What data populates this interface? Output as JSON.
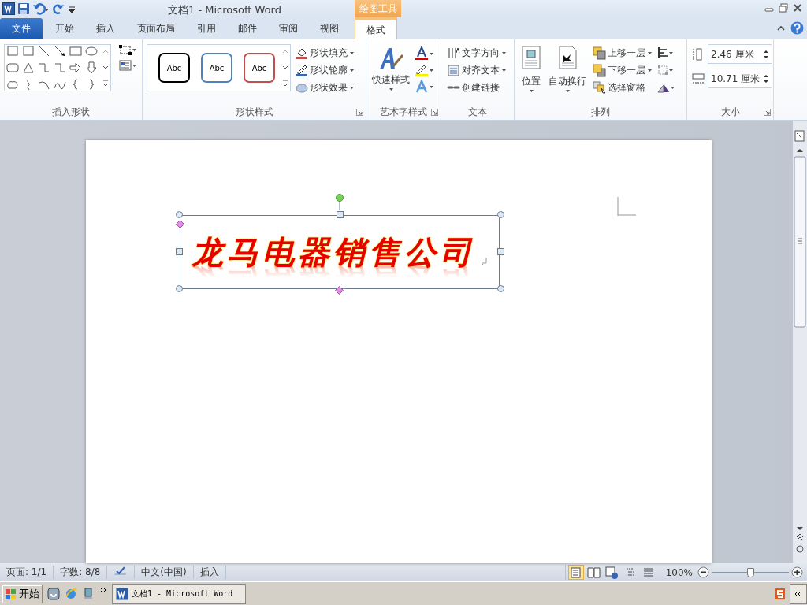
{
  "title_bar": {
    "title": "文档1  -  Microsoft Word",
    "context_label": "绘图工具"
  },
  "tabs": [
    {
      "label": "文件",
      "kind": "file",
      "selected": false
    },
    {
      "label": "开始",
      "kind": "tab",
      "selected": false
    },
    {
      "label": "插入",
      "kind": "tab",
      "selected": false
    },
    {
      "label": "页面布局",
      "kind": "tab",
      "selected": false
    },
    {
      "label": "引用",
      "kind": "tab",
      "selected": false
    },
    {
      "label": "邮件",
      "kind": "tab",
      "selected": false
    },
    {
      "label": "审阅",
      "kind": "tab",
      "selected": false
    },
    {
      "label": "视图",
      "kind": "tab",
      "selected": false
    },
    {
      "label": "格式",
      "kind": "tab",
      "selected": true
    }
  ],
  "ribbon_groups": [
    {
      "kind": "shapes",
      "label": "插入形状"
    },
    {
      "kind": "styles",
      "label": "形状样式",
      "presets": [
        {
          "text": "Abc",
          "color": "#000000"
        },
        {
          "text": "Abc",
          "color": "#4f81bd"
        },
        {
          "text": "Abc",
          "color": "#c0504d"
        }
      ],
      "commands": [
        "形状填充",
        "形状轮廓",
        "形状效果"
      ]
    },
    {
      "kind": "wordart",
      "label": "艺术字样式",
      "commands": [
        "快速样式"
      ]
    },
    {
      "kind": "text",
      "label": "文本",
      "commands": [
        "文字方向",
        "对齐文本",
        "创建链接"
      ]
    },
    {
      "kind": "arrange",
      "label": "排列",
      "commands": [
        "位置",
        "自动换行",
        "上移一层",
        "下移一层",
        "选择窗格"
      ]
    },
    {
      "kind": "size",
      "label": "大小",
      "fields": [
        {
          "value": "2.46 厘米"
        },
        {
          "value": "10.71 厘米"
        }
      ]
    }
  ],
  "document": {
    "wordart_text": "龙马电器销售公司"
  },
  "status_bar": {
    "items": [
      "页面: 1/1",
      "字数: 8/8",
      "中文(中国)",
      "插入"
    ],
    "views": [
      {
        "selected": true
      },
      {
        "selected": false
      },
      {
        "selected": false
      },
      {
        "selected": false
      },
      {
        "selected": false
      }
    ],
    "zoom": "100%",
    "zoom_slider": {
      "level": 0.5
    }
  },
  "taskbar": {
    "start": "开始",
    "tasks": [
      {
        "label": "文档1 - Microsoft Word"
      }
    ]
  }
}
